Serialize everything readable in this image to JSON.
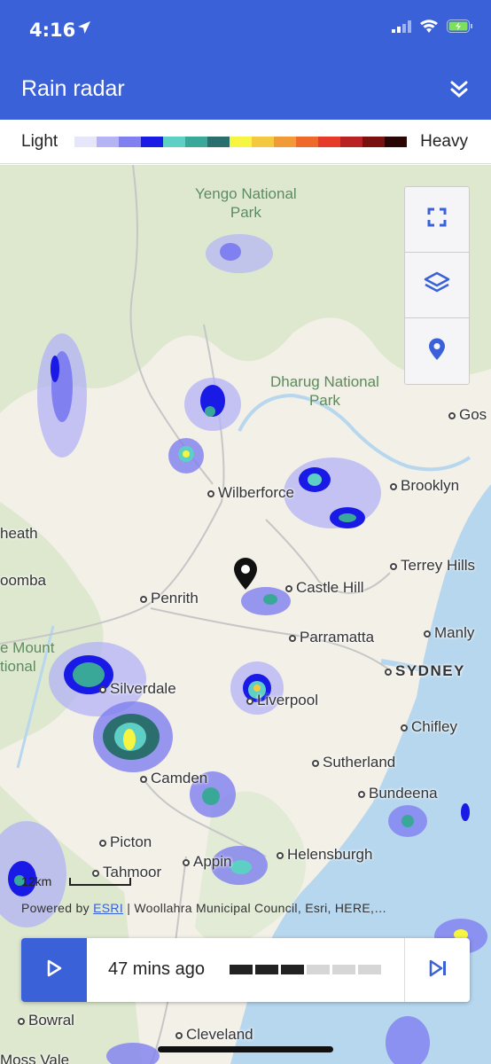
{
  "status_bar": {
    "time": "4:16"
  },
  "header": {
    "title": "Rain radar"
  },
  "legend": {
    "light_label": "Light",
    "heavy_label": "Heavy",
    "colors": [
      "#e6e6fa",
      "#b3b3f5",
      "#8080f0",
      "#1a1ae6",
      "#5ecfc4",
      "#3aa898",
      "#2b6e6e",
      "#f5f542",
      "#f5c842",
      "#f09a3a",
      "#ee6a2a",
      "#e63a2a",
      "#b82222",
      "#7a1111",
      "#2a0505"
    ]
  },
  "map": {
    "parks": [
      {
        "line1": "Yengo National",
        "line2": "Park"
      },
      {
        "line1": "Dharug National",
        "line2": "Park"
      }
    ],
    "places": [
      "Wilberforce",
      "Brooklyn",
      "Gos",
      "heath",
      "Terrey Hills",
      "oomba",
      "Penrith",
      "Castle Hill",
      "Parramatta",
      "Manly",
      "SYDNEY",
      "Silverdale",
      "Liverpool",
      "Chifley",
      "Camden",
      "Sutherland",
      "Bundeena",
      "Picton",
      "Tahmoor",
      "Appin",
      "Helensburgh",
      "Bowral",
      "Cleveland",
      "Moss Vale"
    ],
    "partial_label_1": "e Mount",
    "partial_label_2": "tional",
    "scale_label": "12km",
    "attribution_prefix": "Powered by",
    "attribution_link": "ESRI",
    "attribution_rest": " | Woollahra Municipal Council, Esri, HERE,…"
  },
  "player": {
    "time_ago": "47 mins ago",
    "frames_total": 6,
    "frames_played": 3
  }
}
